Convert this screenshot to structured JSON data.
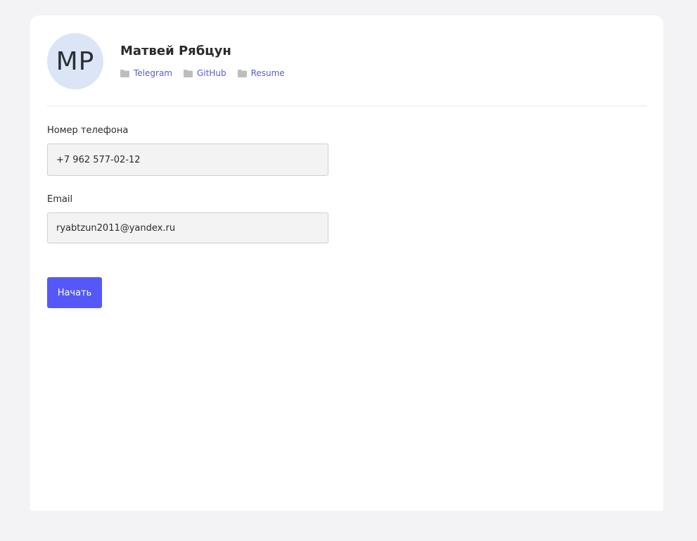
{
  "profile": {
    "initials": "MP",
    "name": "Матвей Рябцун",
    "links": [
      {
        "label": "Telegram",
        "icon": "folder-icon"
      },
      {
        "label": "GitHub",
        "icon": "folder-icon"
      },
      {
        "label": "Resume",
        "icon": "folder-icon"
      }
    ]
  },
  "form": {
    "phone_label": "Номер телефона",
    "phone_value": "+7 962 577-02-12",
    "email_label": "Email",
    "email_value": "ryabtzun2011@yandex.ru",
    "submit_label": "Начать"
  },
  "colors": {
    "accent": "#5558f7",
    "link": "#5b5bd6",
    "avatar_bg": "#dce5f5",
    "page_bg": "#f3f3f5"
  }
}
